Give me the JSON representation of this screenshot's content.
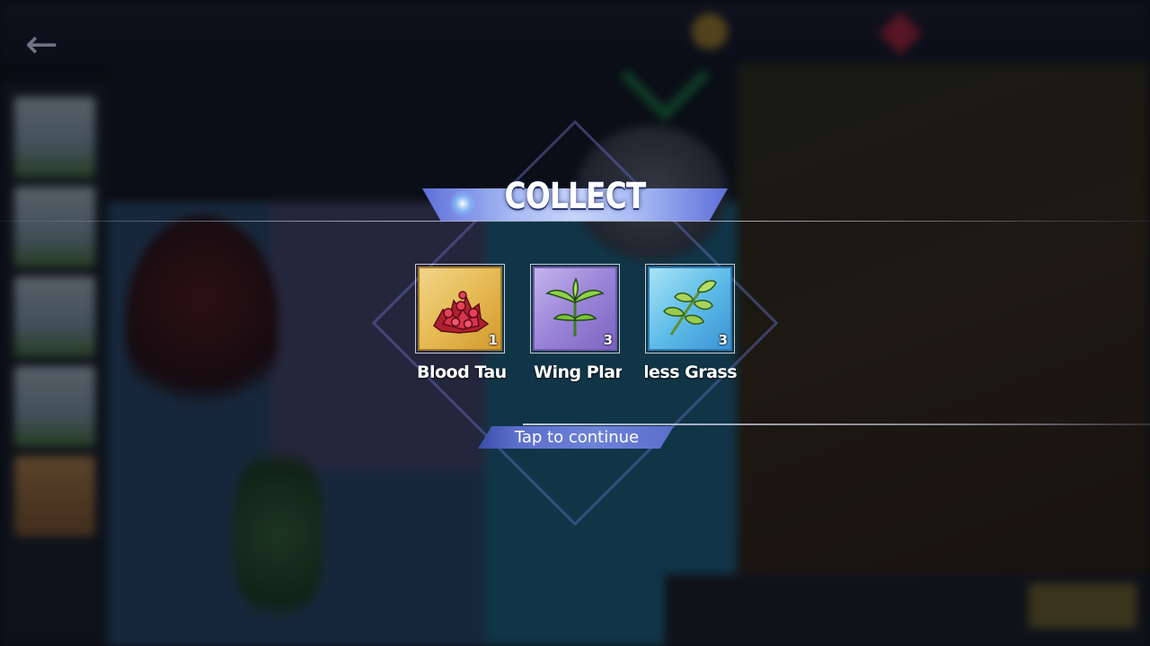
{
  "dialog": {
    "title": "COLLECT",
    "tap_hint": "Tap to continue"
  },
  "items": [
    {
      "name": "Blood Taur",
      "visible_name": "Blood Tau",
      "count": "1",
      "rarity": "gold",
      "icon": "red-berries-icon"
    },
    {
      "name": "Wing Plant",
      "visible_name": "/ing Plant",
      "count": "3",
      "rarity": "purple",
      "icon": "wing-plant-icon"
    },
    {
      "name": "less Grass",
      "visible_name": "less Grass",
      "count": "3",
      "rarity": "blue",
      "icon": "herb-grass-icon"
    }
  ],
  "colors": {
    "banner": "#a9bbf5",
    "tap_bar": "#5b6fcc",
    "gold_tile": "#e7bd58",
    "purple_tile": "#9a84d8",
    "blue_tile": "#5fbde8"
  }
}
